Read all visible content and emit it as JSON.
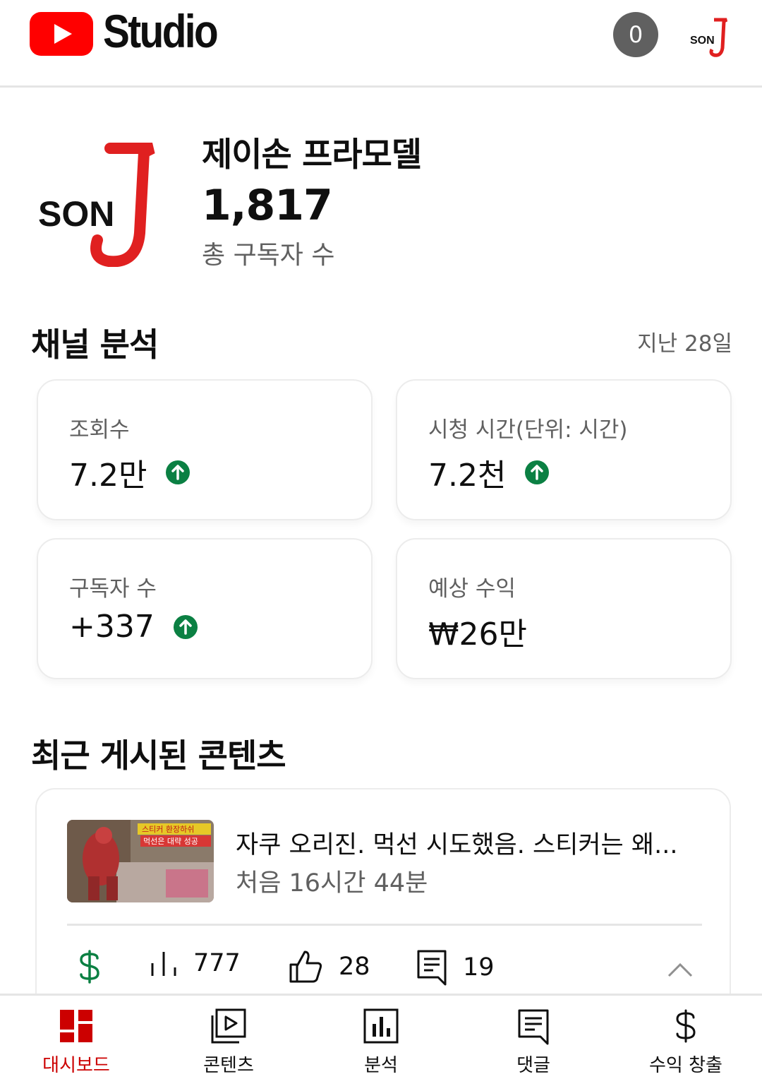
{
  "header": {
    "studio_text": "Studio",
    "notification_count": "0",
    "avatar_text": "SON"
  },
  "channel": {
    "name": "제이손 프라모델",
    "subscriber_count": "1,817",
    "subscriber_label": "총 구독자 수",
    "logo_text": "SON"
  },
  "analytics": {
    "title": "채널 분석",
    "period": "지난 28일",
    "cards": [
      {
        "label": "조회수",
        "value": "7.2만",
        "trend": "up"
      },
      {
        "label": "시청 시간(단위: 시간)",
        "value": "7.2천",
        "trend": "up"
      },
      {
        "label": "구독자 수",
        "value": "+337",
        "trend": "up"
      },
      {
        "label": "예상 수익",
        "value": "₩26만"
      }
    ]
  },
  "recent": {
    "title": "최근 게시된 콘텐츠",
    "video": {
      "title": "자쿠 오리진. 먹선 시도했음. 스티커는 왜...",
      "time": "처음 16시간 44분",
      "thumb_text_1": "스티커 환장하쉬",
      "thumb_text_2": "먹선은 대략 성공",
      "views": "777",
      "likes": "28",
      "comments": "19"
    }
  },
  "nav": {
    "items": [
      {
        "label": "대시보드",
        "active": true
      },
      {
        "label": "콘텐츠"
      },
      {
        "label": "분석"
      },
      {
        "label": "댓글"
      },
      {
        "label": "수익 창출"
      }
    ]
  },
  "colors": {
    "brand_red": "#ff0000",
    "active_red": "#cc0000",
    "trend_green": "#0b8043",
    "money_green": "#0b8043"
  }
}
